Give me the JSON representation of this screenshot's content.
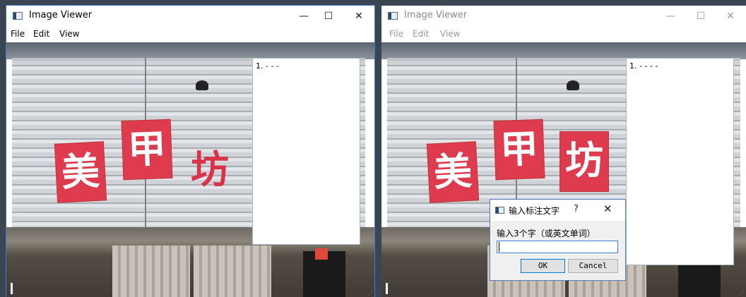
{
  "left_window": {
    "title": "Image Viewer",
    "controls": {
      "minimize": "—",
      "maximize": "☐",
      "close": "✕"
    },
    "menu": [
      "File",
      "Edit",
      "View"
    ],
    "annotation_panel": {
      "text": "1. - - -"
    }
  },
  "right_window": {
    "title": "Image Viewer",
    "controls": {
      "minimize": "—",
      "maximize": "☐",
      "close": "✕"
    },
    "menu": [
      "File",
      "Edit",
      "View"
    ],
    "annotation_panel": {
      "text": "1. - - - -"
    }
  },
  "sign": {
    "chars": [
      "美",
      "甲",
      "坊"
    ],
    "color": "#df3b4f"
  },
  "dialog": {
    "title": "输入标注文字",
    "help": "?",
    "close": "✕",
    "prompt": "输入3个字（或英文单词）",
    "input_value": "",
    "ok_label": "OK",
    "cancel_label": "Cancel"
  }
}
